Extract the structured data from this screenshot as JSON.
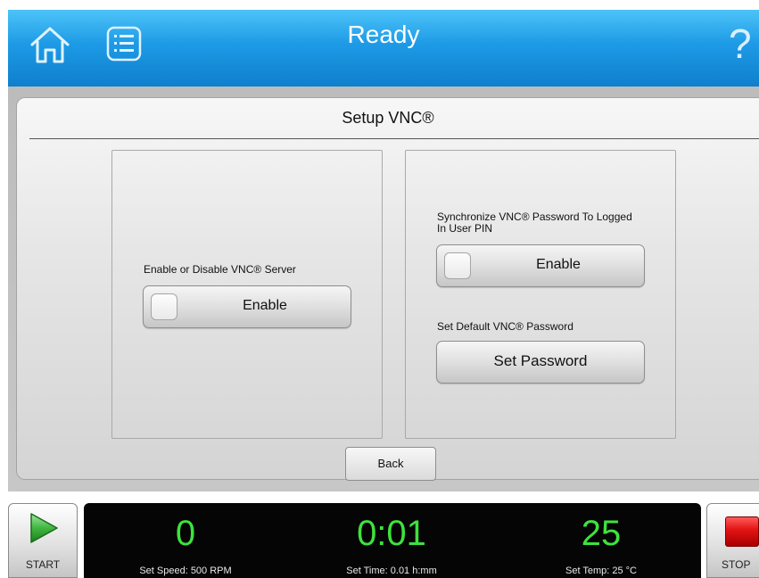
{
  "header": {
    "title": "Ready",
    "home_icon": "home-icon",
    "menu_icon": "menu-list-icon",
    "help_label": "?"
  },
  "page": {
    "title": "Setup VNC®"
  },
  "left_box": {
    "label": "Enable or Disable VNC® Server",
    "toggle": {
      "label": "Enable",
      "state": "off"
    }
  },
  "right_box": {
    "sync_label": "Synchronize VNC® Password To Logged In User PIN",
    "sync_toggle": {
      "label": "Enable",
      "state": "off"
    },
    "password_label": "Set Default VNC® Password",
    "password_button": "Set Password"
  },
  "back_button": "Back",
  "footer": {
    "start_label": "START",
    "stop_label": "STOP",
    "speed": {
      "value": "0",
      "setting": "Set Speed: 500 RPM"
    },
    "time": {
      "value": "0:01",
      "setting": "Set Time: 0.01 h:mm"
    },
    "temp": {
      "value": "25",
      "setting": "Set Temp: 25 °C"
    }
  },
  "colors": {
    "header_blue": "#1d9ae6",
    "readout_green": "#3ee23e",
    "stop_red": "#e11212",
    "start_green": "#3fb63f"
  }
}
